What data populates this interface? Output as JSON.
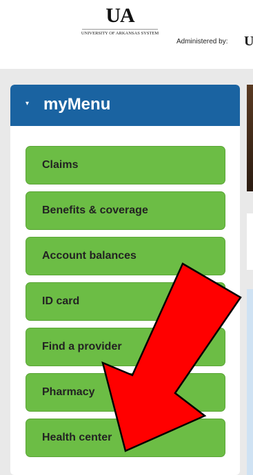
{
  "header": {
    "logo_mark": "UA",
    "logo_subtitle": "UNIVERSITY OF ARKANSAS SYSTEM",
    "administered_by": "Administered by:",
    "admin_logo": "U"
  },
  "menu": {
    "title": "myMenu",
    "caret": "▾",
    "items": [
      {
        "label": "Claims"
      },
      {
        "label": "Benefits & coverage"
      },
      {
        "label": "Account balances"
      },
      {
        "label": "ID card"
      },
      {
        "label": "Find a provider"
      },
      {
        "label": "Pharmacy"
      },
      {
        "label": "Health center"
      }
    ]
  },
  "colors": {
    "menu_header": "#1a63a1",
    "menu_item": "#6cbd45",
    "annotation_arrow": "#ff0000"
  }
}
